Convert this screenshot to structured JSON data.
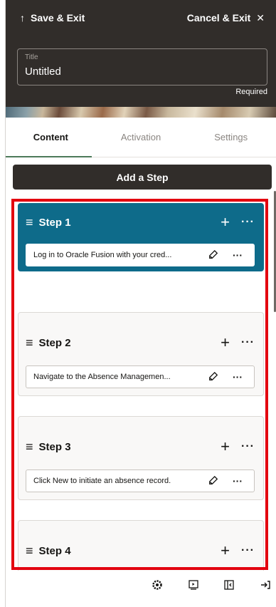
{
  "header": {
    "save_exit_label": "Save & Exit",
    "save_exit_icon": "arrow-up-icon",
    "cancel_exit_label": "Cancel & Exit",
    "cancel_exit_icon": "close-icon",
    "title_label": "Title",
    "title_value": "Untitled",
    "required_text": "Required"
  },
  "tabs": [
    {
      "label": "Content",
      "active": true
    },
    {
      "label": "Activation",
      "active": false
    },
    {
      "label": "Settings",
      "active": false
    }
  ],
  "add_step_label": "Add a Step",
  "steps": [
    {
      "title": "Step 1",
      "description": "Log in to Oracle Fusion with your cred...",
      "active": true
    },
    {
      "title": "Step 2",
      "description": "Navigate to the Absence Managemen...",
      "active": false
    },
    {
      "title": "Step 3",
      "description": "Click New to initiate an absence record.",
      "active": false
    },
    {
      "title": "Step 4",
      "description": "",
      "active": false
    }
  ],
  "footer_icons": [
    "gear-icon",
    "preview-icon",
    "collapse-panel-icon",
    "exit-icon"
  ],
  "colors": {
    "header_bg": "#312d2a",
    "active_step_bg": "#0e6b8a",
    "highlight": "#e3000f",
    "tab_underline": "#4d7a5a"
  }
}
